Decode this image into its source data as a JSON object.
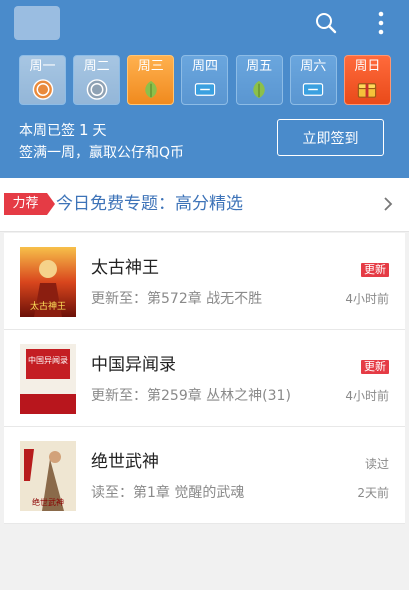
{
  "header": {
    "week": [
      {
        "label": "周一",
        "state": "signed",
        "icon": "signed-stamp-icon"
      },
      {
        "label": "周二",
        "state": "missed",
        "icon": "missed-stamp-icon"
      },
      {
        "label": "周三",
        "state": "today",
        "icon": "leaf-icon"
      },
      {
        "label": "周四",
        "state": "upcoming",
        "icon": "coupon-icon"
      },
      {
        "label": "周五",
        "state": "upcoming",
        "icon": "leaf-icon"
      },
      {
        "label": "周六",
        "state": "upcoming",
        "icon": "coupon-icon"
      },
      {
        "label": "周日",
        "state": "bonus",
        "icon": "gift-chest-icon"
      }
    ],
    "signed_prefix": "本周已签",
    "signed_count": "1",
    "signed_suffix": "天",
    "reward_text": "签满一周，赢取公仔和Q币",
    "signin_button": "立即签到"
  },
  "promo": {
    "tag": "力荐",
    "title": "今日免费专题：高分精选"
  },
  "books": [
    {
      "title": "太古神王",
      "progress": "更新至：第572章 战无不胜",
      "status": "更新",
      "time": "4小时前",
      "cover_text": "太古神王"
    },
    {
      "title": "中国异闻录",
      "progress": "更新至：第259章 丛林之神(31)",
      "status": "更新",
      "time": "4小时前",
      "cover_text": "中国异闻录"
    },
    {
      "title": "绝世武神",
      "progress": "读至：第1章 觉醒的武魂",
      "status": "读过",
      "time": "2天前",
      "cover_text": "绝世武神"
    }
  ],
  "colors": {
    "header_bg": "#4a8bcb",
    "accent_red": "#e53b45",
    "promo_blue": "#3d73b8",
    "today_orange": "#f59a2e"
  }
}
